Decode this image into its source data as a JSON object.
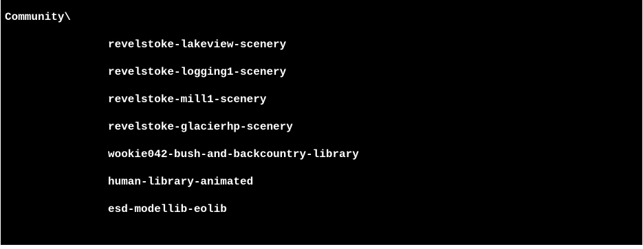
{
  "terminal": {
    "folder": "Community\\",
    "entries": [
      "revelstoke-lakeview-scenery",
      "revelstoke-logging1-scenery",
      "revelstoke-mill1-scenery",
      "revelstoke-glacierhp-scenery",
      "wookie042-bush-and-backcountry-library",
      "human-library-animated",
      "esd-modellib-eolib"
    ]
  },
  "colors": {
    "background": "#000000",
    "text": "#ffffff"
  }
}
